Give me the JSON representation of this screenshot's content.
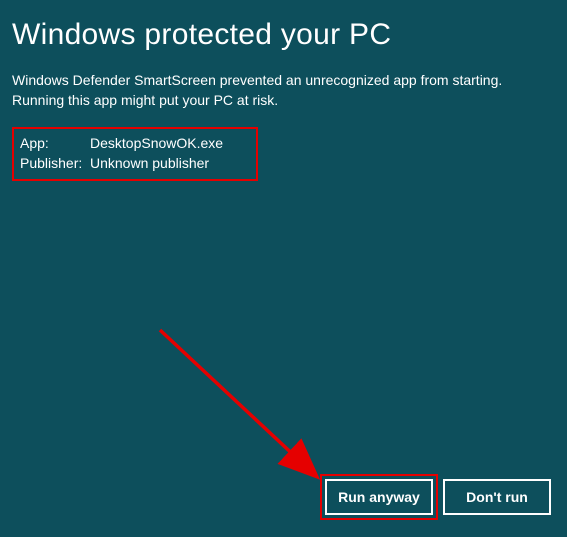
{
  "title": "Windows protected your PC",
  "description": "Windows Defender SmartScreen prevented an unrecognized app from starting. Running this app might put your PC at risk.",
  "details": {
    "app_label": "App:",
    "app_value": "DesktopSnowOK.exe",
    "publisher_label": "Publisher:",
    "publisher_value": "Unknown publisher"
  },
  "buttons": {
    "run_anyway": "Run anyway",
    "dont_run": "Don't run"
  },
  "colors": {
    "background": "#0d4f5c",
    "text": "#ffffff",
    "highlight": "#e50000"
  }
}
